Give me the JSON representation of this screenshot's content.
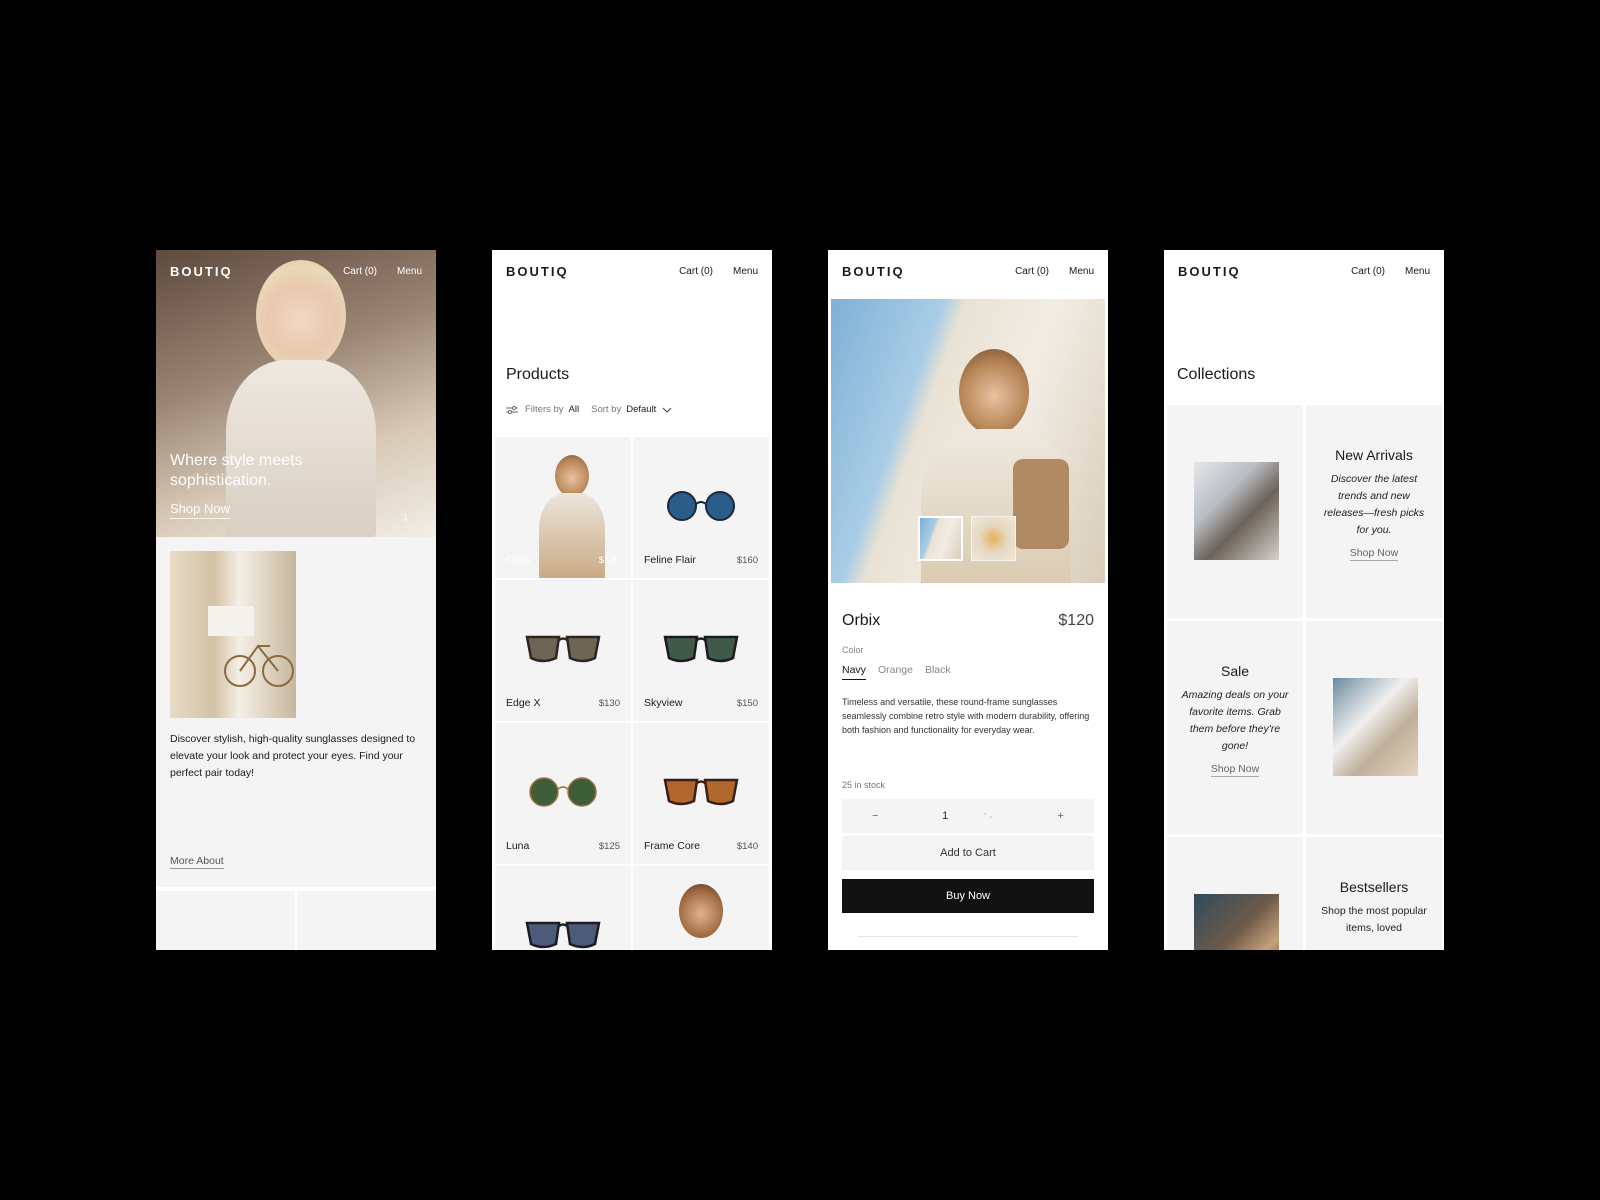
{
  "brand": "BOUTIQ",
  "nav": {
    "cart_label": "Cart (0)",
    "menu_label": "Menu"
  },
  "home": {
    "hero_title": "Where style meets sophistication.",
    "hero_cta": "Shop Now",
    "hero_arrow_icon": "arrow-down-icon",
    "intro_text": "Discover stylish, high-quality sunglasses designed to elevate your look and protect your eyes. Find your perfect pair today!",
    "more_link": "More About"
  },
  "products_page": {
    "title": "Products",
    "filter_icon": "sliders-icon",
    "filter_label": "Filters by",
    "filter_value": "All",
    "sort_label": "Sort by",
    "sort_value": "Default",
    "items": [
      {
        "name": "Orbix",
        "price": "$120",
        "lens": "#6b5a4a",
        "frame": "#3a2e26"
      },
      {
        "name": "Feline Flair",
        "price": "$160",
        "lens": "#2a5d8a",
        "frame": "#1b2a3a"
      },
      {
        "name": "Edge X",
        "price": "$130",
        "lens": "#6f6555",
        "frame": "#2d2620"
      },
      {
        "name": "Skyview",
        "price": "$150",
        "lens": "#3f5a48",
        "frame": "#1a1c1c"
      },
      {
        "name": "Luna",
        "price": "$125",
        "lens": "#3e5e3a",
        "frame": "#a0723e"
      },
      {
        "name": "Frame Core",
        "price": "$140",
        "lens": "#b0672e",
        "frame": "#3b1f14"
      },
      {
        "name": "",
        "price": "",
        "lens": "#4e5a7a",
        "frame": "#1c1c24"
      },
      {
        "name": "",
        "price": "",
        "lens": "",
        "frame": ""
      }
    ]
  },
  "product_detail": {
    "name": "Orbix",
    "price": "$120",
    "color_label": "Color",
    "colors": [
      "Navy",
      "Orange",
      "Black"
    ],
    "selected_color": "Navy",
    "description": "Timeless and versatile, these round-frame sunglasses seamlessly combine retro style with modern durability, offering both fashion and functionality for everyday wear.",
    "stock": "25 in stock",
    "quantity": "1",
    "minus": "−",
    "plus": "+",
    "spin": "⌃⌄",
    "add_to_cart": "Add to Cart",
    "buy_now": "Buy Now"
  },
  "collections_page": {
    "title": "Collections",
    "items": [
      {
        "title": "New Arrivals",
        "description": "Discover the latest trends and new releases—fresh picks for you.",
        "link": "Shop Now"
      },
      {
        "title": "Sale",
        "description": "Amazing deals on your favorite items. Grab them before they're gone!",
        "link": "Shop Now"
      },
      {
        "title": "Bestsellers",
        "description": "Shop the most popular items, loved",
        "link": ""
      }
    ]
  },
  "colors": {
    "background": "#000000",
    "panel": "#f4f4f4",
    "primary_button": "#111111"
  }
}
